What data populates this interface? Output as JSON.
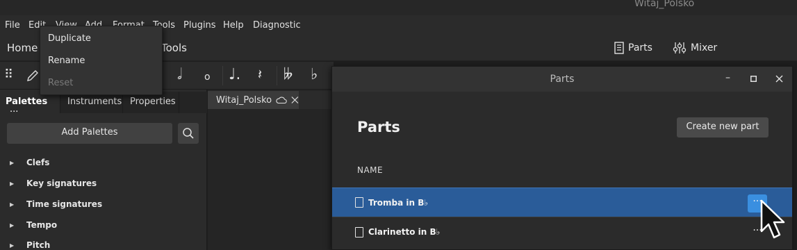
{
  "window": {
    "title": "Witaj_Polsko"
  },
  "menubar": {
    "items": [
      "File",
      "Edit",
      "View",
      "Add",
      "Format",
      "Tools",
      "Plugins",
      "Help",
      "Diagnostic"
    ]
  },
  "context_menu": {
    "items": [
      {
        "label": "Duplicate",
        "enabled": true
      },
      {
        "label": "Rename",
        "enabled": true
      },
      {
        "label": "Reset",
        "enabled": false
      }
    ]
  },
  "navbar": {
    "home": "Home",
    "tools": "Tools",
    "parts_label": "Parts",
    "mixer_label": "Mixer"
  },
  "toolbar": {
    "icons": [
      "drag-handle-icon",
      "pencil-icon",
      "half-note-icon",
      "whole-note-icon",
      "dotted-quarter-note-icon",
      "quarter-rest-icon",
      "double-flat-icon",
      "flat-icon"
    ]
  },
  "left_panel": {
    "tabs": {
      "palettes": "Palettes",
      "palettes_menu": "···",
      "instruments": "Instruments",
      "properties": "Properties"
    },
    "add_palettes_label": "Add Palettes",
    "palettes": [
      "Clefs",
      "Key signatures",
      "Time signatures",
      "Tempo",
      "Pitch"
    ]
  },
  "document_tab": {
    "name": "Witaj_Polsko"
  },
  "parts_dialog": {
    "title": "Parts",
    "heading": "Parts",
    "create_new_part": "Create new part",
    "column_name": "NAME",
    "rows": [
      {
        "name": "Tromba in B♭",
        "selected": true,
        "menu": "···"
      },
      {
        "name": "Clarinetto in B♭",
        "selected": false,
        "menu": "···"
      }
    ]
  },
  "colors": {
    "accent_selected_row": "#2a5c99",
    "accent_button": "#3a8fe0",
    "background": "#1e1e1e"
  }
}
